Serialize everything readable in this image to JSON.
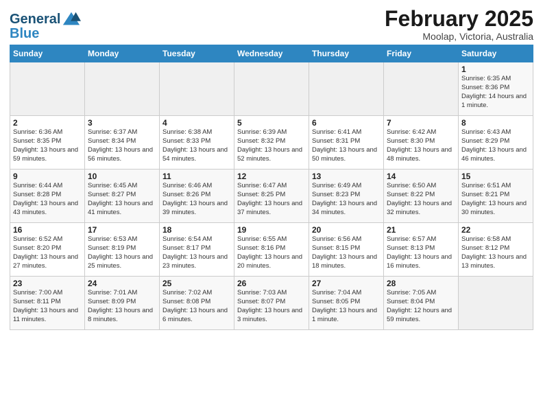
{
  "header": {
    "logo_line1": "General",
    "logo_line2": "Blue",
    "month": "February 2025",
    "location": "Moolap, Victoria, Australia"
  },
  "weekdays": [
    "Sunday",
    "Monday",
    "Tuesday",
    "Wednesday",
    "Thursday",
    "Friday",
    "Saturday"
  ],
  "weeks": [
    [
      {
        "day": "",
        "info": ""
      },
      {
        "day": "",
        "info": ""
      },
      {
        "day": "",
        "info": ""
      },
      {
        "day": "",
        "info": ""
      },
      {
        "day": "",
        "info": ""
      },
      {
        "day": "",
        "info": ""
      },
      {
        "day": "1",
        "info": "Sunrise: 6:35 AM\nSunset: 8:36 PM\nDaylight: 14 hours\nand 1 minute."
      }
    ],
    [
      {
        "day": "2",
        "info": "Sunrise: 6:36 AM\nSunset: 8:35 PM\nDaylight: 13 hours\nand 59 minutes."
      },
      {
        "day": "3",
        "info": "Sunrise: 6:37 AM\nSunset: 8:34 PM\nDaylight: 13 hours\nand 56 minutes."
      },
      {
        "day": "4",
        "info": "Sunrise: 6:38 AM\nSunset: 8:33 PM\nDaylight: 13 hours\nand 54 minutes."
      },
      {
        "day": "5",
        "info": "Sunrise: 6:39 AM\nSunset: 8:32 PM\nDaylight: 13 hours\nand 52 minutes."
      },
      {
        "day": "6",
        "info": "Sunrise: 6:41 AM\nSunset: 8:31 PM\nDaylight: 13 hours\nand 50 minutes."
      },
      {
        "day": "7",
        "info": "Sunrise: 6:42 AM\nSunset: 8:30 PM\nDaylight: 13 hours\nand 48 minutes."
      },
      {
        "day": "8",
        "info": "Sunrise: 6:43 AM\nSunset: 8:29 PM\nDaylight: 13 hours\nand 46 minutes."
      }
    ],
    [
      {
        "day": "9",
        "info": "Sunrise: 6:44 AM\nSunset: 8:28 PM\nDaylight: 13 hours\nand 43 minutes."
      },
      {
        "day": "10",
        "info": "Sunrise: 6:45 AM\nSunset: 8:27 PM\nDaylight: 13 hours\nand 41 minutes."
      },
      {
        "day": "11",
        "info": "Sunrise: 6:46 AM\nSunset: 8:26 PM\nDaylight: 13 hours\nand 39 minutes."
      },
      {
        "day": "12",
        "info": "Sunrise: 6:47 AM\nSunset: 8:25 PM\nDaylight: 13 hours\nand 37 minutes."
      },
      {
        "day": "13",
        "info": "Sunrise: 6:49 AM\nSunset: 8:23 PM\nDaylight: 13 hours\nand 34 minutes."
      },
      {
        "day": "14",
        "info": "Sunrise: 6:50 AM\nSunset: 8:22 PM\nDaylight: 13 hours\nand 32 minutes."
      },
      {
        "day": "15",
        "info": "Sunrise: 6:51 AM\nSunset: 8:21 PM\nDaylight: 13 hours\nand 30 minutes."
      }
    ],
    [
      {
        "day": "16",
        "info": "Sunrise: 6:52 AM\nSunset: 8:20 PM\nDaylight: 13 hours\nand 27 minutes."
      },
      {
        "day": "17",
        "info": "Sunrise: 6:53 AM\nSunset: 8:19 PM\nDaylight: 13 hours\nand 25 minutes."
      },
      {
        "day": "18",
        "info": "Sunrise: 6:54 AM\nSunset: 8:17 PM\nDaylight: 13 hours\nand 23 minutes."
      },
      {
        "day": "19",
        "info": "Sunrise: 6:55 AM\nSunset: 8:16 PM\nDaylight: 13 hours\nand 20 minutes."
      },
      {
        "day": "20",
        "info": "Sunrise: 6:56 AM\nSunset: 8:15 PM\nDaylight: 13 hours\nand 18 minutes."
      },
      {
        "day": "21",
        "info": "Sunrise: 6:57 AM\nSunset: 8:13 PM\nDaylight: 13 hours\nand 16 minutes."
      },
      {
        "day": "22",
        "info": "Sunrise: 6:58 AM\nSunset: 8:12 PM\nDaylight: 13 hours\nand 13 minutes."
      }
    ],
    [
      {
        "day": "23",
        "info": "Sunrise: 7:00 AM\nSunset: 8:11 PM\nDaylight: 13 hours\nand 11 minutes."
      },
      {
        "day": "24",
        "info": "Sunrise: 7:01 AM\nSunset: 8:09 PM\nDaylight: 13 hours\nand 8 minutes."
      },
      {
        "day": "25",
        "info": "Sunrise: 7:02 AM\nSunset: 8:08 PM\nDaylight: 13 hours\nand 6 minutes."
      },
      {
        "day": "26",
        "info": "Sunrise: 7:03 AM\nSunset: 8:07 PM\nDaylight: 13 hours\nand 3 minutes."
      },
      {
        "day": "27",
        "info": "Sunrise: 7:04 AM\nSunset: 8:05 PM\nDaylight: 13 hours\nand 1 minute."
      },
      {
        "day": "28",
        "info": "Sunrise: 7:05 AM\nSunset: 8:04 PM\nDaylight: 12 hours\nand 59 minutes."
      },
      {
        "day": "",
        "info": ""
      }
    ]
  ]
}
